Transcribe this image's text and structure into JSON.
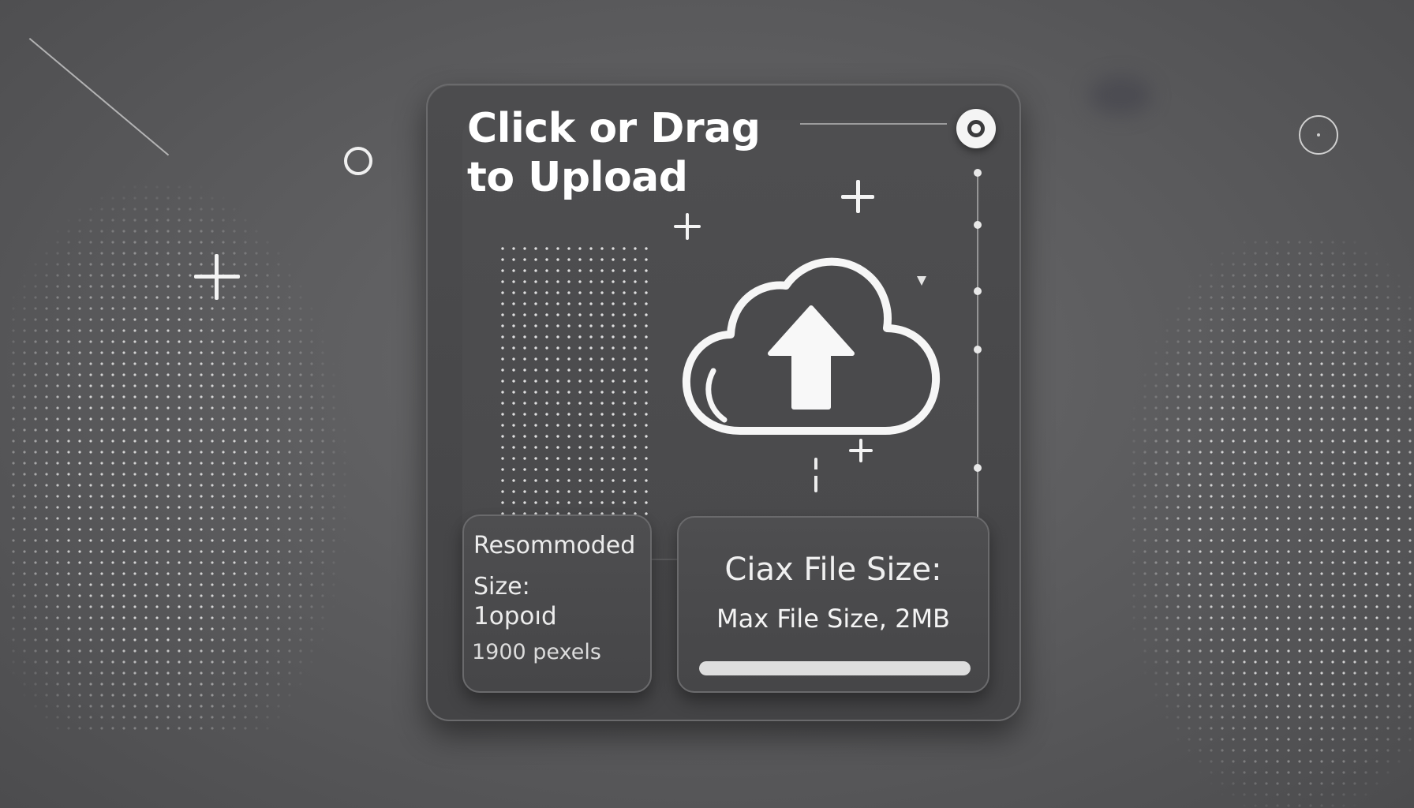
{
  "upload": {
    "title_line1": "Click or Drag",
    "title_line2": "to  Upload"
  },
  "recommended": {
    "label": "Resommoded Size:",
    "value": "1opoıd",
    "pixels": "1900 pexels"
  },
  "max_size": {
    "heading": "Ciax File Size:",
    "text": "Max File Size, 2MB",
    "progress_fraction": 1.0
  },
  "icons": {
    "cloud": "cloud-upload-icon",
    "close": "close-icon",
    "plus": "plus-icon",
    "ring": "ring-icon"
  },
  "colors": {
    "background": "#5e5e60",
    "card": "#4a4a4c",
    "text": "#ffffff",
    "accent": "#f4f4f4"
  }
}
